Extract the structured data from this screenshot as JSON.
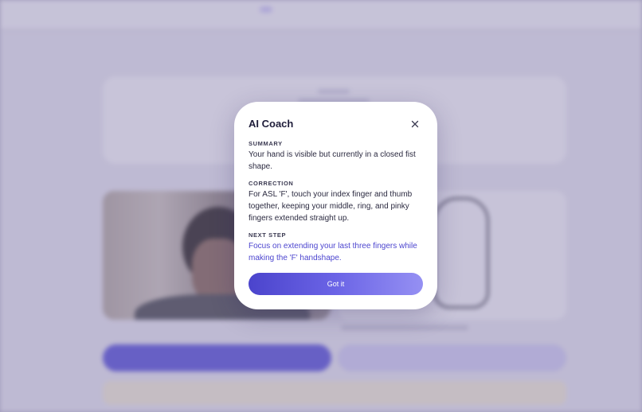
{
  "background": {
    "brand": "",
    "nav": [
      "",
      "",
      "",
      ""
    ],
    "signin": "",
    "back": "",
    "page_title": "",
    "page_right": "",
    "camera_label": "",
    "primary_button": "",
    "secondary_button": "",
    "warning": ""
  },
  "modal": {
    "title": "AI Coach",
    "sections": [
      {
        "label": "SUMMARY",
        "text": "Your hand is visible but currently in a closed fist shape."
      },
      {
        "label": "CORRECTION",
        "text": "For ASL 'F', touch your index finger and thumb together, keeping your middle, ring, and pinky fingers extended straight up."
      },
      {
        "label": "NEXT STEP",
        "text": "Focus on extending your last three fingers while making the 'F' handshape."
      }
    ],
    "button_label": "Got it"
  },
  "colors": {
    "accent": "#5d56dc",
    "next_step_text": "#4c45cf",
    "overlay": "#7872a0"
  }
}
